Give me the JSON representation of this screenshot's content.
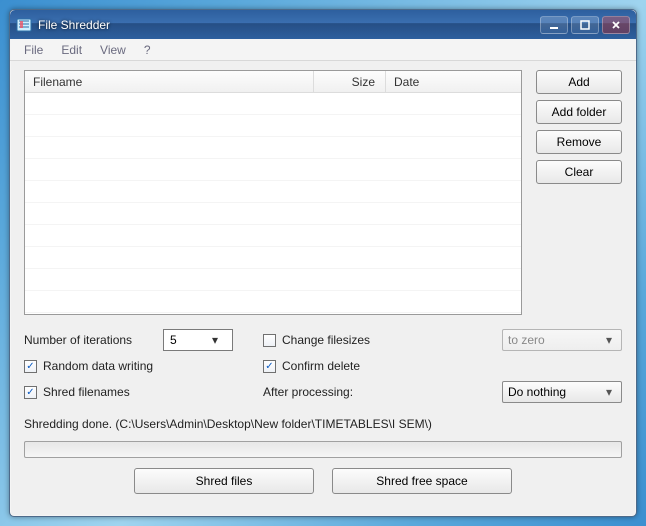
{
  "title": "File Shredder",
  "menu": {
    "file": "File",
    "edit": "Edit",
    "view": "View",
    "help": "?"
  },
  "columns": {
    "filename": "Filename",
    "size": "Size",
    "date": "Date"
  },
  "side": {
    "add": "Add",
    "add_folder": "Add folder",
    "remove": "Remove",
    "clear": "Clear"
  },
  "options": {
    "iterations_label": "Number of iterations",
    "iterations_value": "5",
    "random_writing": "Random data writing",
    "shred_filenames": "Shred filenames",
    "change_filesizes": "Change filesizes",
    "confirm_delete": "Confirm delete",
    "after_processing": "After processing:",
    "filesizes_select": "to zero",
    "after_select": "Do nothing"
  },
  "status": "Shredding done. (C:\\Users\\Admin\\Desktop\\New folder\\TIMETABLES\\I SEM\\)",
  "bottom": {
    "shred_files": "Shred files",
    "shred_free_space": "Shred free space"
  }
}
